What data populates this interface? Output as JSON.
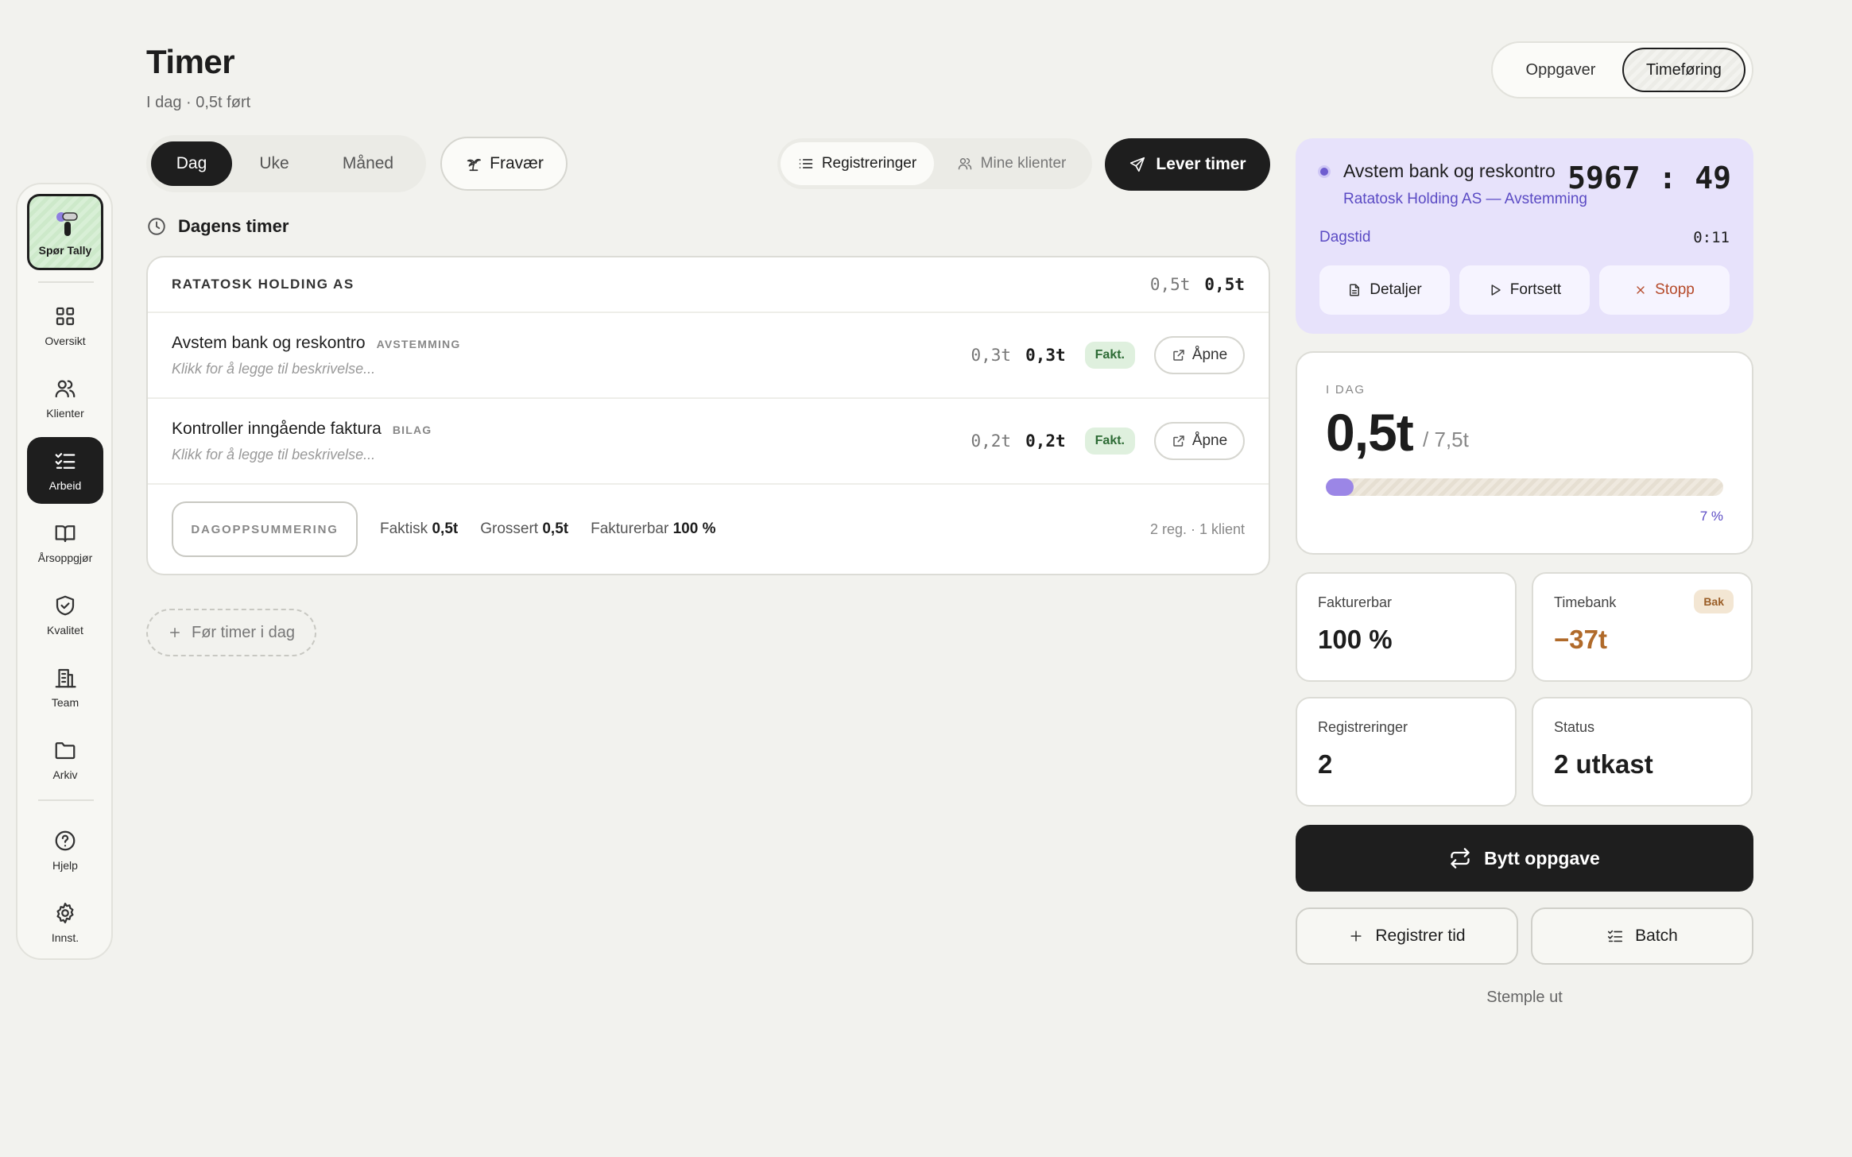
{
  "sidebar": {
    "tally_label": "Spør Tally",
    "items": [
      {
        "label": "Oversikt",
        "icon": "grid-icon"
      },
      {
        "label": "Klienter",
        "icon": "users-icon"
      },
      {
        "label": "Arbeid",
        "icon": "checklist-icon",
        "active": true
      },
      {
        "label": "Årsoppgjør",
        "icon": "book-icon"
      },
      {
        "label": "Kvalitet",
        "icon": "shield-check-icon"
      },
      {
        "label": "Team",
        "icon": "building-icon"
      },
      {
        "label": "Arkiv",
        "icon": "folder-icon"
      }
    ],
    "bottom": [
      {
        "label": "Hjelp",
        "icon": "help-icon"
      },
      {
        "label": "Innst.",
        "icon": "gear-icon"
      }
    ]
  },
  "header": {
    "title": "Timer",
    "subtitle": "I dag · 0,5t ført",
    "view_tabs": [
      "Oppgaver",
      "Timeføring"
    ],
    "active_view": "Timeføring"
  },
  "toolbar": {
    "periods": [
      "Dag",
      "Uke",
      "Måned"
    ],
    "active_period": "Dag",
    "absence_label": "Fravær",
    "list_toggle": [
      "Registreringer",
      "Mine klienter"
    ],
    "submit_label": "Lever timer"
  },
  "day": {
    "heading": "Dagens timer",
    "client": "RATATOSK HOLDING AS",
    "client_hours_actual": "0,5t",
    "client_hours_billed": "0,5t",
    "entries": [
      {
        "name": "Avstem bank og reskontro",
        "tag": "AVSTEMMING",
        "desc": "Klikk for å legge til beskrivelse...",
        "actual": "0,3t",
        "billed": "0,3t",
        "badge": "Fakt.",
        "open_label": "Åpne"
      },
      {
        "name": "Kontroller inngående faktura",
        "tag": "BILAG",
        "desc": "Klikk for å legge til beskrivelse...",
        "actual": "0,2t",
        "billed": "0,2t",
        "badge": "Fakt.",
        "open_label": "Åpne"
      }
    ],
    "summary": {
      "label": "DAGOPPSUMMERING",
      "faktisk_label": "Faktisk",
      "faktisk_value": "0,5t",
      "grossert_label": "Grossert",
      "grossert_value": "0,5t",
      "fakturerbar_label": "Fakturerbar",
      "fakturerbar_value": "100 %",
      "right": "2 reg. · 1 klient"
    },
    "add_label": "Før timer i dag"
  },
  "timer": {
    "title": "Avstem bank og reskontro",
    "subtitle": "Ratatosk Holding AS — Avstemming",
    "elapsed": "5967 : 49",
    "dagstid_label": "Dagstid",
    "dagstid_value": "0:11",
    "buttons": [
      "Detaljer",
      "Fortsett",
      "Stopp"
    ]
  },
  "today": {
    "label": "I DAG",
    "value": "0,5t",
    "target": "/ 7,5t",
    "progress_percent": 7,
    "progress_label": "7 %"
  },
  "stats": [
    {
      "label": "Fakturerbar",
      "value": "100 %"
    },
    {
      "label": "Timebank",
      "value": "−37t",
      "badge": "Bak"
    },
    {
      "label": "Registreringer",
      "value": "2"
    },
    {
      "label": "Status",
      "value": "2 utkast"
    }
  ],
  "actions": {
    "switch_task": "Bytt oppgave",
    "register_time": "Registrer tid",
    "batch": "Batch",
    "clock_out": "Stemple ut"
  },
  "colors": {
    "accent": "#6e5ccf",
    "dark": "#1e1e1e",
    "negative": "#b06a2a",
    "billable_badge": "#dff0de"
  }
}
